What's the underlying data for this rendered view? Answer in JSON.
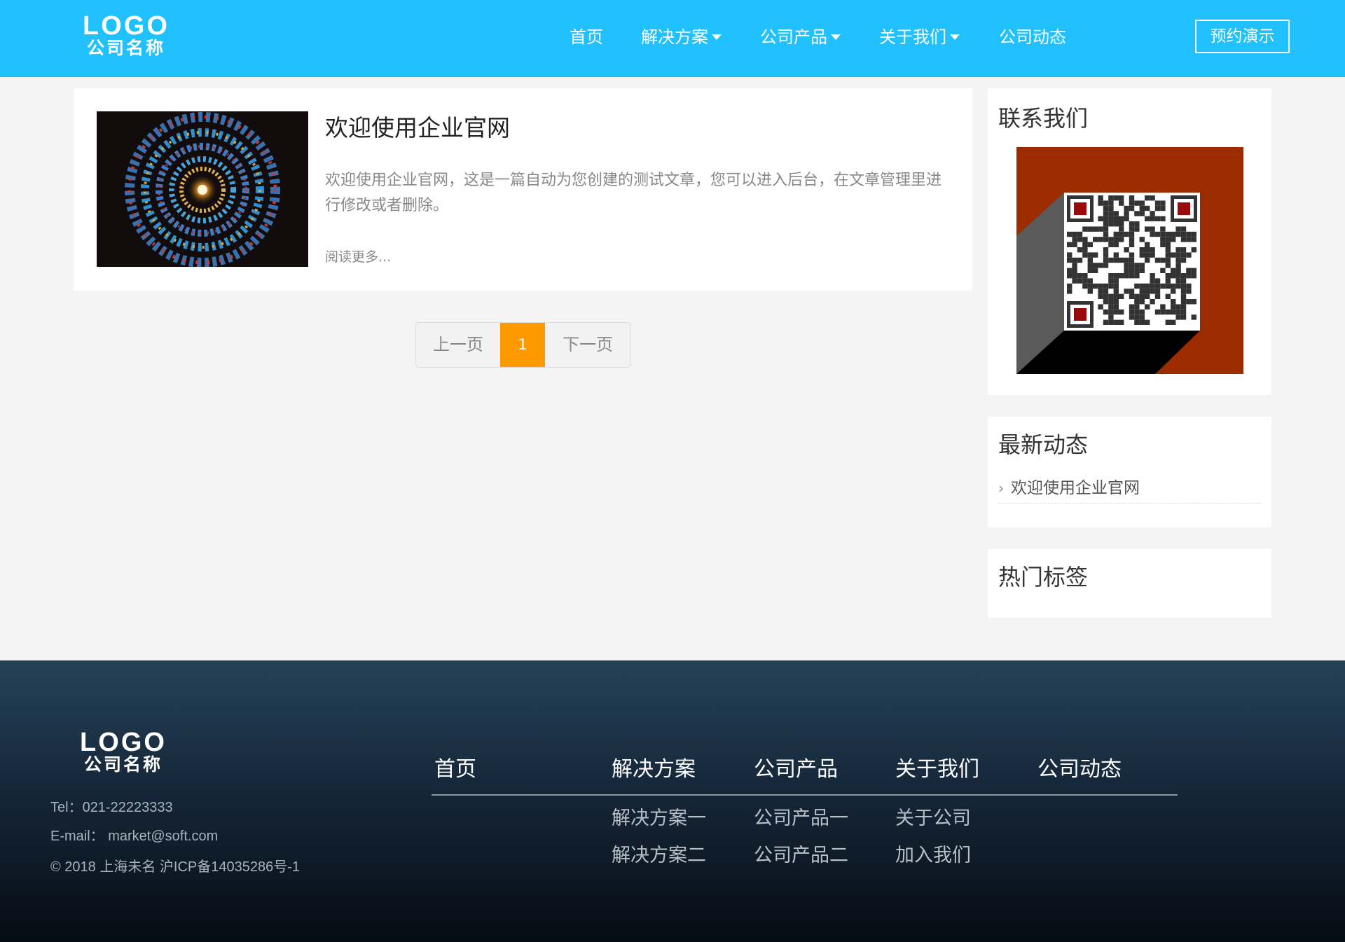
{
  "header": {
    "logo": {
      "word": "LOGO",
      "sub": "公司名称"
    },
    "nav": [
      {
        "label": "首页",
        "has_dropdown": false
      },
      {
        "label": "解决方案",
        "has_dropdown": true
      },
      {
        "label": "公司产品",
        "has_dropdown": true
      },
      {
        "label": "关于我们",
        "has_dropdown": true
      },
      {
        "label": "公司动态",
        "has_dropdown": false
      }
    ],
    "demo_button": "预约演示"
  },
  "article": {
    "title": "欢迎使用企业官网",
    "excerpt": "欢迎使用企业官网，这是一篇自动为您创建的测试文章，您可以进入后台，在文章管理里进行修改或者删除。",
    "read_more": "阅读更多..."
  },
  "pagination": {
    "prev": "上一页",
    "current": "1",
    "next": "下一页"
  },
  "sidebar": {
    "contact_title": "联系我们",
    "news_title": "最新动态",
    "news_items": [
      "欢迎使用企业官网"
    ],
    "tags_title": "热门标签"
  },
  "footer": {
    "logo": {
      "word": "LOGO",
      "sub": "公司名称"
    },
    "tel": "Tel：021-22223333",
    "email": "E-mail：  market@soft.com",
    "copyright": "© 2018 上海未名 沪ICP备14035286号-1",
    "columns": [
      {
        "title": "首页",
        "items": []
      },
      {
        "title": "解决方案",
        "items": [
          "解决方案一",
          "解决方案二"
        ]
      },
      {
        "title": "公司产品",
        "items": [
          "公司产品一",
          "公司产品二"
        ]
      },
      {
        "title": "关于我们",
        "items": [
          "关于公司",
          "加入我们"
        ]
      },
      {
        "title": "公司动态",
        "items": []
      }
    ]
  },
  "colors": {
    "header_bg": "#21c0fe",
    "pager_active": "#ff9900",
    "qr_bg": "#9c2b00",
    "footer_top": "#254257",
    "footer_bottom": "#050c12"
  }
}
